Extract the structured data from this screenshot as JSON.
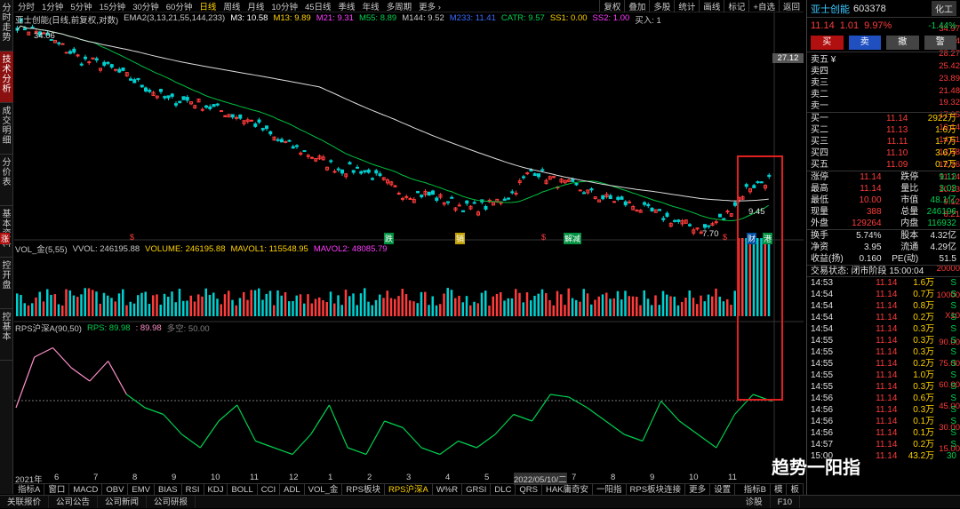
{
  "topbar": {
    "items": [
      "分时",
      "1分钟",
      "5分钟",
      "15分钟",
      "30分钟",
      "60分钟",
      "日线",
      "周线",
      "月线",
      "10分钟",
      "45日线",
      "季线",
      "年线",
      "多周期",
      "更多 ›"
    ],
    "active": "日线",
    "right": [
      "复权",
      "叠加",
      "多股",
      "统计",
      "画线",
      "标记",
      "+自选",
      "返回"
    ]
  },
  "left_tabs": [
    "分时走势",
    "技术分析",
    "成交明细",
    "分价表",
    "基本资料",
    "控开盘",
    "控基本"
  ],
  "left_active": 1,
  "main": {
    "title": "亚士创能(日线,前复权,对数)",
    "ema": [
      {
        "t": "EMA2(3,13,21,55,144,233)",
        "c": "#c8c8c8"
      },
      {
        "t": "M3: 10.58",
        "c": "#ffffff"
      },
      {
        "t": "M13: 9.89",
        "c": "#ffd200"
      },
      {
        "t": "M21: 9.31",
        "c": "#ff3bff"
      },
      {
        "t": "M55: 8.89",
        "c": "#00d050"
      },
      {
        "t": "M144: 9.52",
        "c": "#c8c8c8"
      },
      {
        "t": "M233: 11.41",
        "c": "#3a6bff"
      },
      {
        "t": "CATR: 9.57",
        "c": "#00d050"
      },
      {
        "t": "SS1: 0.00",
        "c": "#ffd200"
      },
      {
        "t": "SS2: 1.00",
        "c": "#ff3bff"
      },
      {
        "t": "买入: 1",
        "c": "#c8c8c8"
      }
    ],
    "yticks": [
      "34.97",
      "31.44",
      "28.27",
      "25.42",
      "23.89",
      "21.48",
      "19.32",
      "17.95",
      "16.14",
      "14.51",
      "13.48",
      "12.26",
      "11.14",
      "10.13",
      "9.12",
      "8.21"
    ],
    "current": "27.12",
    "marks": [
      {
        "t": "34.06",
        "c": "#e0e0e0"
      },
      {
        "t": "9.45",
        "c": "#e0e0e0"
      },
      {
        "t": "7.70",
        "c": "#e0e0e0"
      }
    ],
    "events": [
      {
        "t": "$",
        "c": "#ff3b3b"
      },
      {
        "t": "跌",
        "bg": "#009040"
      },
      {
        "t": "销",
        "bg": "#c0a000"
      },
      {
        "t": "$",
        "c": "#ff3b3b"
      },
      {
        "t": "解减",
        "bg": "#009040"
      },
      {
        "t": "$",
        "c": "#ff3b3b"
      },
      {
        "t": "财",
        "bg": "#004fa0"
      },
      {
        "t": "港",
        "bg": "#009040"
      },
      {
        "t": "涨",
        "bg": "#b01010"
      }
    ]
  },
  "vol": {
    "legend": [
      {
        "t": "VOL_金(5,55)",
        "c": "#c8c8c8"
      },
      {
        "t": "VVOL: 246195.88",
        "c": "#c8c8c8"
      },
      {
        "t": "VOLUME: 246195.88",
        "c": "#ffd200"
      },
      {
        "t": "MAVOL1: 115548.95",
        "c": "#ffd200"
      },
      {
        "t": "MAVOL2: 48085.79",
        "c": "#ff3bff"
      }
    ],
    "yticks": [
      "20000",
      "10000"
    ],
    "unit": "X10"
  },
  "rps": {
    "legend": [
      {
        "t": "RPS沪深A(90,50)",
        "c": "#c8c8c8"
      },
      {
        "t": "RPS: 89.98",
        "c": "#00d050"
      },
      {
        "t": ": 89.98",
        "c": "#ff8fc8"
      },
      {
        "t": "多空: 50.00",
        "c": "#808080"
      }
    ],
    "yticks": [
      "90.00",
      "75.00",
      "60.00",
      "45.00",
      "30.00",
      "15.00"
    ]
  },
  "xaxis": [
    "2021年",
    "6",
    "7",
    "8",
    "9",
    "10",
    "11",
    "12",
    "1",
    "2",
    "3",
    "4",
    "5",
    "2022/05/10/二",
    "7",
    "8",
    "9",
    "10",
    "11"
  ],
  "bottom_tabs": [
    "指标A",
    "窗口",
    "MACD",
    "OBV",
    "EMV",
    "BIAS",
    "RSI",
    "KDJ",
    "BOLL",
    "CCI",
    "ADL",
    "VOL_金",
    "RPS板块",
    "RPS沪深A",
    "W%R",
    "GRSI",
    "DLC",
    "QRS",
    "HAK庸奇安",
    "一阳指",
    "RPS板块连接",
    "更多",
    "设置"
  ],
  "bottom_active": "RPS沪深A",
  "bottom_right": [
    "指标B",
    "模",
    "板"
  ],
  "status": [
    "关联报价",
    "公司公告",
    "公司新闻",
    "公司研报"
  ],
  "status_right": [
    "诊股",
    "F10"
  ],
  "quote": {
    "name": "亚士创能",
    "code": "603378",
    "industry": "化工",
    "ind_change": "-1.44%",
    "price": "11.14",
    "chg": "1.01",
    "pct": "9.97%",
    "btns": [
      "买",
      "卖",
      "撤",
      "警"
    ],
    "sells": [
      {
        "l": "卖五 ¥",
        "p": "",
        "v": ""
      },
      {
        "l": "卖四",
        "p": "",
        "v": ""
      },
      {
        "l": "卖三",
        "p": "",
        "v": ""
      },
      {
        "l": "卖二",
        "p": "",
        "v": ""
      },
      {
        "l": "卖一",
        "p": "",
        "v": ""
      }
    ],
    "buys": [
      {
        "l": "买一",
        "p": "11.14",
        "v": "2922万"
      },
      {
        "l": "买二",
        "p": "11.13",
        "v": "1.6万"
      },
      {
        "l": "买三",
        "p": "11.11",
        "v": "1.7万"
      },
      {
        "l": "买四",
        "p": "11.10",
        "v": "3.6万"
      },
      {
        "l": "买五",
        "p": "11.09",
        "v": "0.7万"
      }
    ],
    "stats": [
      [
        "涨停",
        "11.14",
        "跌停",
        "9.12"
      ],
      [
        "最高",
        "11.14",
        "量比",
        "3.03"
      ],
      [
        "最低",
        "10.00",
        "市值",
        "48.1亿"
      ],
      [
        "现量",
        "388",
        "总量",
        "246196"
      ],
      [
        "外盘",
        "129264",
        "内盘",
        "116932"
      ]
    ],
    "stats2": [
      [
        "换手",
        "5.74%",
        "股本",
        "4.32亿"
      ],
      [
        "净资",
        "3.95",
        "流通",
        "4.29亿"
      ],
      [
        "收益(扬)",
        "0.160",
        "PE(动)",
        "51.5"
      ]
    ],
    "state": "交易状态: 闭市阶段 15:00:04",
    "ticks": [
      [
        "14:53",
        "11.14",
        "1.6万",
        "S"
      ],
      [
        "14:54",
        "11.14",
        "0.7万",
        "S"
      ],
      [
        "14:54",
        "11.14",
        "0.8万",
        "S"
      ],
      [
        "14:54",
        "11.14",
        "0.2万",
        "S"
      ],
      [
        "14:54",
        "11.14",
        "0.3万",
        "S"
      ],
      [
        "14:55",
        "11.14",
        "0.3万",
        "S"
      ],
      [
        "14:55",
        "11.14",
        "0.3万",
        "S"
      ],
      [
        "14:55",
        "11.14",
        "0.2万",
        "S"
      ],
      [
        "14:55",
        "11.14",
        "1.0万",
        "S"
      ],
      [
        "14:55",
        "11.14",
        "0.3万",
        "S"
      ],
      [
        "14:56",
        "11.14",
        "0.6万",
        "S"
      ],
      [
        "14:56",
        "11.14",
        "0.3万",
        "S"
      ],
      [
        "14:56",
        "11.14",
        "0.1万",
        "S"
      ],
      [
        "14:56",
        "11.14",
        "0.1万",
        "S"
      ],
      [
        "14:57",
        "11.14",
        "0.2万",
        "S"
      ],
      [
        "15:00",
        "11.14",
        "43.2万",
        "30"
      ]
    ],
    "watermark": "趋势一阳指"
  },
  "chart_data": {
    "type": "line",
    "title": "亚士创能(日线,前复权,对数)",
    "series": [
      {
        "name": "RPS",
        "values": [
          50,
          88,
          95,
          80,
          70,
          85,
          60,
          50,
          45,
          30,
          20,
          40,
          52,
          25,
          20,
          15,
          30,
          52,
          20,
          15,
          40,
          35,
          20,
          15,
          25,
          20,
          30,
          45,
          40,
          60,
          58,
          50,
          40,
          30,
          25,
          55,
          40,
          30,
          20,
          45,
          60,
          55
        ]
      }
    ],
    "price_range": [
      7.7,
      34.97
    ],
    "last": 11.14
  }
}
